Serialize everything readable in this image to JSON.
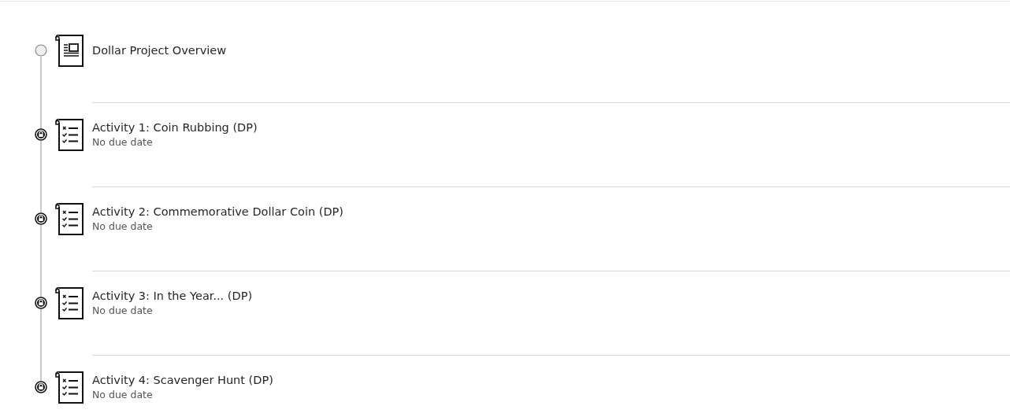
{
  "items": [
    {
      "kind": "document",
      "title": "Dollar Project Overview",
      "locked": false
    },
    {
      "kind": "assignment",
      "title": "Activity 1: Coin Rubbing (DP)",
      "due": "No due date",
      "locked": true
    },
    {
      "kind": "assignment",
      "title": "Activity 2: Commemorative Dollar Coin (DP)",
      "due": "No due date",
      "locked": true
    },
    {
      "kind": "assignment",
      "title": "Activity 3: In the Year... (DP)",
      "due": "No due date",
      "locked": true
    },
    {
      "kind": "assignment",
      "title": "Activity 4: Scavenger Hunt (DP)",
      "due": "No due date",
      "locked": true
    }
  ]
}
